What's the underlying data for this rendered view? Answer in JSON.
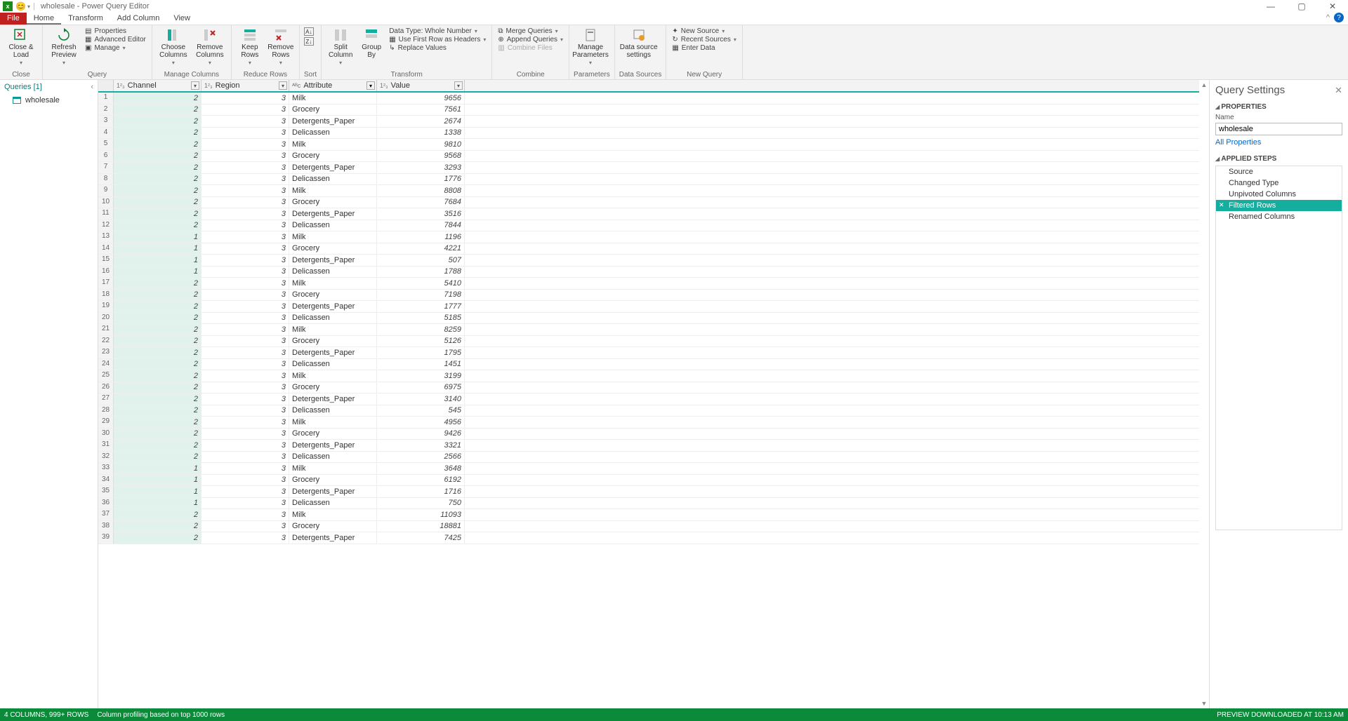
{
  "window": {
    "title": "wholesale - Power Query Editor"
  },
  "tabs": {
    "file": "File",
    "items": [
      "Home",
      "Transform",
      "Add Column",
      "View"
    ],
    "active": "Home"
  },
  "ribbon": {
    "close": {
      "closeLoad": "Close &\nLoad",
      "group": "Close"
    },
    "query": {
      "refresh": "Refresh\nPreview",
      "properties": "Properties",
      "advanced": "Advanced Editor",
      "manage": "Manage",
      "group": "Query"
    },
    "manageCols": {
      "choose": "Choose\nColumns",
      "remove": "Remove\nColumns",
      "group": "Manage Columns"
    },
    "reduceRows": {
      "keep": "Keep\nRows",
      "removeR": "Remove\nRows",
      "group": "Reduce Rows"
    },
    "sort": {
      "group": "Sort"
    },
    "transform": {
      "split": "Split\nColumn",
      "groupBy": "Group\nBy",
      "dataType": "Data Type: Whole Number",
      "firstRow": "Use First Row as Headers",
      "replace": "Replace Values",
      "group": "Transform"
    },
    "combine": {
      "merge": "Merge Queries",
      "append": "Append Queries",
      "combineFiles": "Combine Files",
      "group": "Combine"
    },
    "params": {
      "manage": "Manage\nParameters",
      "group": "Parameters"
    },
    "dataSources": {
      "settings": "Data source\nsettings",
      "group": "Data Sources"
    },
    "newQuery": {
      "newSource": "New Source",
      "recent": "Recent Sources",
      "enter": "Enter Data",
      "group": "New Query"
    }
  },
  "queriesPane": {
    "header": "Queries [1]",
    "item": "wholesale"
  },
  "columns": [
    {
      "name": "Channel",
      "type": "1²₃"
    },
    {
      "name": "Region",
      "type": "1²₃"
    },
    {
      "name": "Attribute",
      "type": "ᴬᴮc",
      "filtered": true
    },
    {
      "name": "Value",
      "type": "1²₃"
    }
  ],
  "rows": [
    {
      "channel": 2,
      "region": 3,
      "attribute": "Milk",
      "value": 9656
    },
    {
      "channel": 2,
      "region": 3,
      "attribute": "Grocery",
      "value": 7561
    },
    {
      "channel": 2,
      "region": 3,
      "attribute": "Detergents_Paper",
      "value": 2674
    },
    {
      "channel": 2,
      "region": 3,
      "attribute": "Delicassen",
      "value": 1338
    },
    {
      "channel": 2,
      "region": 3,
      "attribute": "Milk",
      "value": 9810
    },
    {
      "channel": 2,
      "region": 3,
      "attribute": "Grocery",
      "value": 9568
    },
    {
      "channel": 2,
      "region": 3,
      "attribute": "Detergents_Paper",
      "value": 3293
    },
    {
      "channel": 2,
      "region": 3,
      "attribute": "Delicassen",
      "value": 1776
    },
    {
      "channel": 2,
      "region": 3,
      "attribute": "Milk",
      "value": 8808
    },
    {
      "channel": 2,
      "region": 3,
      "attribute": "Grocery",
      "value": 7684
    },
    {
      "channel": 2,
      "region": 3,
      "attribute": "Detergents_Paper",
      "value": 3516
    },
    {
      "channel": 2,
      "region": 3,
      "attribute": "Delicassen",
      "value": 7844
    },
    {
      "channel": 1,
      "region": 3,
      "attribute": "Milk",
      "value": 1196
    },
    {
      "channel": 1,
      "region": 3,
      "attribute": "Grocery",
      "value": 4221
    },
    {
      "channel": 1,
      "region": 3,
      "attribute": "Detergents_Paper",
      "value": 507
    },
    {
      "channel": 1,
      "region": 3,
      "attribute": "Delicassen",
      "value": 1788
    },
    {
      "channel": 2,
      "region": 3,
      "attribute": "Milk",
      "value": 5410
    },
    {
      "channel": 2,
      "region": 3,
      "attribute": "Grocery",
      "value": 7198
    },
    {
      "channel": 2,
      "region": 3,
      "attribute": "Detergents_Paper",
      "value": 1777
    },
    {
      "channel": 2,
      "region": 3,
      "attribute": "Delicassen",
      "value": 5185
    },
    {
      "channel": 2,
      "region": 3,
      "attribute": "Milk",
      "value": 8259
    },
    {
      "channel": 2,
      "region": 3,
      "attribute": "Grocery",
      "value": 5126
    },
    {
      "channel": 2,
      "region": 3,
      "attribute": "Detergents_Paper",
      "value": 1795
    },
    {
      "channel": 2,
      "region": 3,
      "attribute": "Delicassen",
      "value": 1451
    },
    {
      "channel": 2,
      "region": 3,
      "attribute": "Milk",
      "value": 3199
    },
    {
      "channel": 2,
      "region": 3,
      "attribute": "Grocery",
      "value": 6975
    },
    {
      "channel": 2,
      "region": 3,
      "attribute": "Detergents_Paper",
      "value": 3140
    },
    {
      "channel": 2,
      "region": 3,
      "attribute": "Delicassen",
      "value": 545
    },
    {
      "channel": 2,
      "region": 3,
      "attribute": "Milk",
      "value": 4956
    },
    {
      "channel": 2,
      "region": 3,
      "attribute": "Grocery",
      "value": 9426
    },
    {
      "channel": 2,
      "region": 3,
      "attribute": "Detergents_Paper",
      "value": 3321
    },
    {
      "channel": 2,
      "region": 3,
      "attribute": "Delicassen",
      "value": 2566
    },
    {
      "channel": 1,
      "region": 3,
      "attribute": "Milk",
      "value": 3648
    },
    {
      "channel": 1,
      "region": 3,
      "attribute": "Grocery",
      "value": 6192
    },
    {
      "channel": 1,
      "region": 3,
      "attribute": "Detergents_Paper",
      "value": 1716
    },
    {
      "channel": 1,
      "region": 3,
      "attribute": "Delicassen",
      "value": 750
    },
    {
      "channel": 2,
      "region": 3,
      "attribute": "Milk",
      "value": 11093
    },
    {
      "channel": 2,
      "region": 3,
      "attribute": "Grocery",
      "value": 18881
    },
    {
      "channel": 2,
      "region": 3,
      "attribute": "Detergents_Paper",
      "value": 7425
    }
  ],
  "querySettings": {
    "title": "Query Settings",
    "properties": "PROPERTIES",
    "nameLabel": "Name",
    "nameValue": "wholesale",
    "allProps": "All Properties",
    "applied": "APPLIED STEPS",
    "steps": [
      "Source",
      "Changed Type",
      "Unpivoted Columns",
      "Filtered Rows",
      "Renamed Columns"
    ],
    "selectedStep": "Filtered Rows"
  },
  "status": {
    "left1": "4 COLUMNS, 999+ ROWS",
    "left2": "Column profiling based on top 1000 rows",
    "right": "PREVIEW DOWNLOADED AT 10:13 AM"
  }
}
